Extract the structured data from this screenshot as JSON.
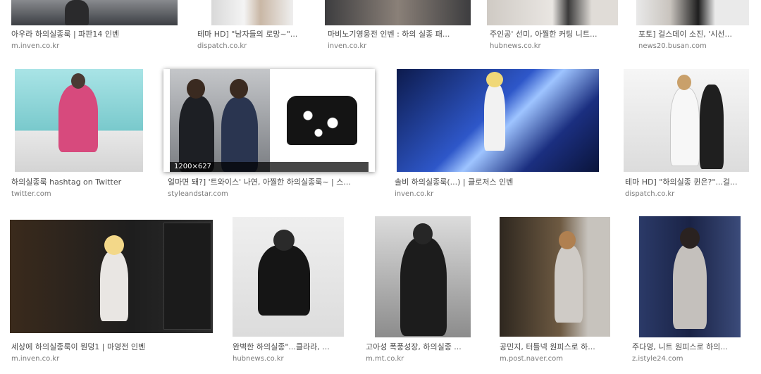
{
  "results": [
    {
      "title": "아우라 하의실종룩 | 파판14 인벤",
      "source": "m.inven.co.kr"
    },
    {
      "title": "테마 HD] \"남자들의 로망~\"...",
      "source": "dispatch.co.kr"
    },
    {
      "title": "마비노기영웅전 인벤 : 하의 실종 패...",
      "source": "inven.co.kr"
    },
    {
      "title": "주인공' 선미, 아찔한 커팅 니트...",
      "source": "hubnews.co.kr"
    },
    {
      "title": "포토] 걸스데이 소진, '시선...",
      "source": "news20.busan.com"
    },
    {
      "title": "하의실종룩 hashtag on Twitter",
      "source": "twitter.com"
    },
    {
      "title": "얼마면 돼?] '트와이스' 나연, 아찔한 하의실종룩~ | 스...",
      "source": "styleandstar.com",
      "dims": "1200×627"
    },
    {
      "title": "솔비 하의실종룩(...) | 클로저스 인벤",
      "source": "inven.co.kr"
    },
    {
      "title": "테마 HD] \"하의실종 퀸은?\"...걸...",
      "source": "dispatch.co.kr"
    },
    {
      "title": "세상에 하의실종룩이 뭔덩1 | 마영전 인벤",
      "source": "m.inven.co.kr"
    },
    {
      "title": "완벽한 하의실종\"...클라라, ...",
      "source": "hubnews.co.kr"
    },
    {
      "title": "고아성 폭풍성장, 하의실종 ...",
      "source": "m.mt.co.kr"
    },
    {
      "title": "공민지, 터틀넥 원피스로 하...",
      "source": "m.post.naver.com"
    },
    {
      "title": "주다영, 니트 원피스로 하의...",
      "source": "z.istyle24.com"
    }
  ]
}
